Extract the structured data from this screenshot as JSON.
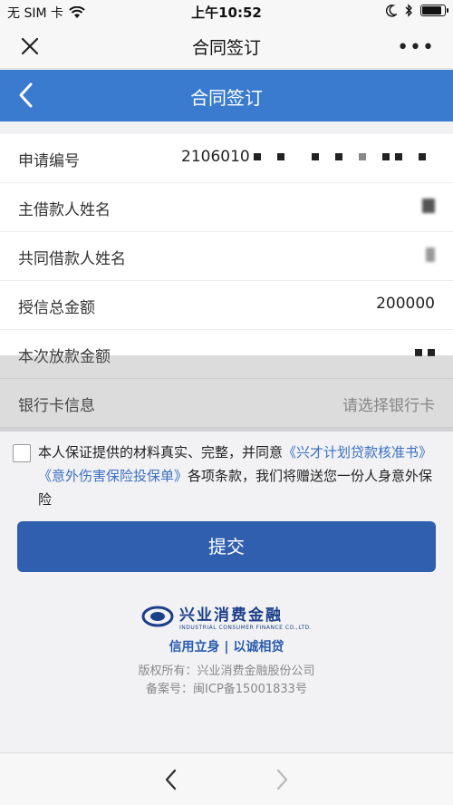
{
  "status_bar": {
    "carrier": "无 SIM 卡",
    "time": "上午10:52",
    "battery_level": 0.9
  },
  "wechat_bar": {
    "title": "合同签订",
    "close_icon": "close-icon",
    "more_label": "•••"
  },
  "page_header": {
    "title": "合同签订",
    "back_icon": "chevron-left-icon"
  },
  "form": {
    "rows": [
      {
        "label": "申请编号",
        "value": "2106010"
      },
      {
        "label": "主借款人姓名",
        "value": ""
      },
      {
        "label": "共同借款人姓名",
        "value": ""
      },
      {
        "label": "授信总金额",
        "value": "200000"
      },
      {
        "label": "本次放款金额",
        "value": ""
      },
      {
        "label": "银行卡信息",
        "value": "请选择银行卡"
      }
    ]
  },
  "agreement": {
    "prefix": "本人保证提供的材料真实、完整，并同意",
    "link1": "《兴才计划贷款核准书》",
    "link2": "《意外伤害保险投保单》",
    "suffix": "各项条款，我们将赠送您一份人身意外保险",
    "checked": false
  },
  "submit_label": "提交",
  "footer": {
    "brand_cn": "兴业消费金融",
    "brand_en": "INDUSTRIAL CONSUMER FINANCE CO.,LTD.",
    "slogan": "信用立身 | 以诚相贷",
    "copyright": "版权所有：兴业消费金融股份公司",
    "icp": "备案号：闽ICP备15001833号"
  },
  "colors": {
    "header_blue": "#3a7bd0",
    "button_blue": "#2f5fae",
    "link_blue": "#3a6fc4"
  }
}
